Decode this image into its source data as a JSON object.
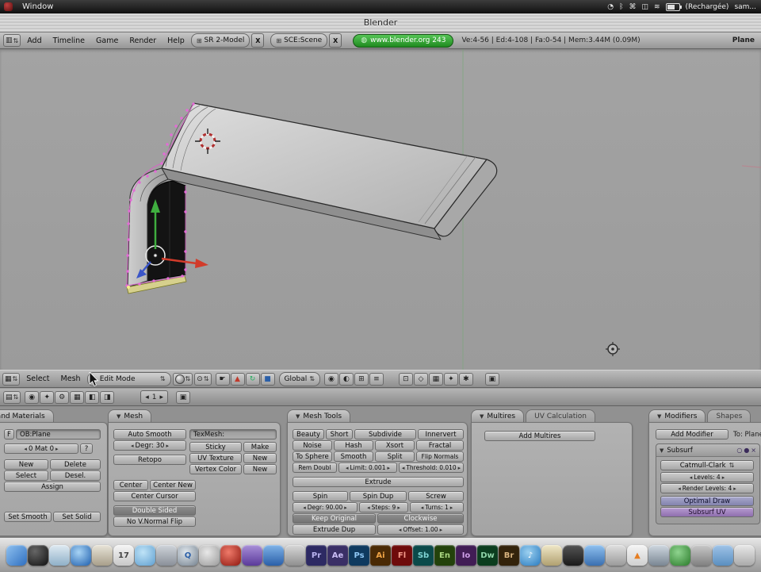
{
  "mac": {
    "window_menu": "Window",
    "status_icons": [
      "◔",
      "ᛒ",
      "⌘",
      "◫",
      "≋"
    ],
    "battery_label": "(Rechargée)",
    "user_label": "sam..."
  },
  "window": {
    "title": "Blender"
  },
  "top_header": {
    "menus": [
      "Add",
      "Timeline",
      "Game",
      "Render",
      "Help"
    ],
    "screen": "SR 2-Model",
    "screen_close": "X",
    "scene": "SCE:Scene",
    "scene_close": "X",
    "site_pill": "www.blender.org 243",
    "stats": "Ve:4-56 | Ed:4-108 | Fa:0-54 | Mem:3.44M (0.09M)",
    "object_name": "Plane"
  },
  "viewport_header": {
    "select": "Select",
    "mesh": "Mesh",
    "mode": "Edit Mode",
    "orientation": "Global"
  },
  "buttons_header": {
    "frame": "1"
  },
  "panels": {
    "link": {
      "title": "Link and Materials",
      "f": "F",
      "ob": "OB:Plane",
      "mat": "0 Mat 0",
      "help": "?",
      "new": "New",
      "delete": "Delete",
      "select": "Select",
      "desel": "Desel.",
      "assign": "Assign",
      "set_smooth": "Set Smooth",
      "set_solid": "Set Solid"
    },
    "mesh": {
      "title": "Mesh",
      "auto_smooth": "Auto Smooth",
      "degr": "Degr: 30",
      "retopo": "Retopo",
      "texmesh": "TexMesh:",
      "sticky": "Sticky",
      "make": "Make",
      "uv_texture": "UV Texture",
      "uv_new": "New",
      "vertex_color": "Vertex Color",
      "vcol_new": "New",
      "center": "Center",
      "center_new": "Center New",
      "center_cursor": "Center Cursor",
      "double_sided": "Double Sided",
      "no_vnormal": "No V.Normal Flip"
    },
    "mesh_tools": {
      "title": "Mesh Tools",
      "beauty": "Beauty",
      "short": "Short",
      "subdivide": "Subdivide",
      "innervert": "Innervert",
      "noise": "Noise",
      "hash": "Hash",
      "xsort": "Xsort",
      "fractal": "Fractal",
      "to_sphere": "To Sphere",
      "smooth": "Smooth",
      "split": "Split",
      "flip_normals": "Flip Normals",
      "rem_doubl": "Rem Doubl",
      "limit": "Limit: 0.001",
      "threshold": "Threshold: 0.010",
      "extrude": "Extrude",
      "spin": "Spin",
      "spin_dup": "Spin Dup",
      "screw": "Screw",
      "degr": "Degr: 90.00",
      "steps": "Steps: 9",
      "turns": "Turns: 1",
      "keep_original": "Keep Original",
      "clockwise": "Clockwise",
      "extrude_dup": "Extrude Dup",
      "offset": "Offset: 1.00"
    },
    "multires": {
      "title": "Multires",
      "tab_uv": "UV Calculation",
      "add_multires": "Add Multires"
    },
    "modifiers": {
      "title": "Modifiers",
      "tab_shapes": "Shapes",
      "add_modifier": "Add Modifier",
      "to": "To: Plane",
      "name": "Subsurf",
      "type": "Catmull-Clark",
      "levels": "Levels: 4",
      "render_levels": "Render Levels: 4",
      "optimal": "Optimal Draw",
      "subsurf_uv": "Subsurf UV"
    }
  },
  "dock": {
    "items": [
      {
        "name": "finder",
        "bg": "linear-gradient(135deg,#8fc1f0,#2f6fc0)",
        "label": ""
      },
      {
        "name": "dashboard",
        "bg": "radial-gradient(circle at 35% 30%,#666,#111)",
        "label": ""
      },
      {
        "name": "mail",
        "bg": "linear-gradient(#dfeaf2,#8fb0c8)",
        "label": ""
      },
      {
        "name": "browser",
        "bg": "radial-gradient(circle at 40% 35%,#a8d4f5,#1e5fae)",
        "label": ""
      },
      {
        "name": "address-book",
        "bg": "linear-gradient(#e8e4d8,#a89f8a)",
        "label": ""
      },
      {
        "name": "ical",
        "bg": "linear-gradient(#f5f5f5,#c8c8c8)",
        "label": "17",
        "fg": "#444"
      },
      {
        "name": "ichat",
        "bg": "radial-gradient(circle at 40% 35%,#bfe3f7,#5f9fd0)",
        "label": ""
      },
      {
        "name": "system-prefs",
        "bg": "linear-gradient(#cfd4da,#8a9099)",
        "label": ""
      },
      {
        "name": "quicktime",
        "bg": "radial-gradient(circle at 40% 35%,#dfe6ec,#75828f)",
        "label": "Q",
        "fg": "#2a5fa8"
      },
      {
        "name": "dvd-player",
        "bg": "radial-gradient(circle at 40% 35%,#e8e8e8,#9a9a9a)",
        "label": ""
      },
      {
        "name": "red-app",
        "bg": "radial-gradient(circle at 40% 35%,#ef7a6a,#8f1810)",
        "label": ""
      },
      {
        "name": "purple-app",
        "bg": "linear-gradient(#a88fd8,#5a3a9a)",
        "label": ""
      },
      {
        "name": "blue-app",
        "bg": "linear-gradient(#7fb3e8,#2a5fa8)",
        "label": ""
      },
      {
        "name": "gray-app",
        "bg": "linear-gradient(#d8d8d8,#8f8f8f)",
        "label": ""
      },
      {
        "name": "premiere",
        "bg": "#2d2a63",
        "label": "Pr",
        "fg": "#b9b3ef",
        "shape": "sq"
      },
      {
        "name": "after-effects",
        "bg": "#3a2f66",
        "label": "Ae",
        "fg": "#cabdf5",
        "shape": "sq"
      },
      {
        "name": "photoshop",
        "bg": "#0f3a5f",
        "label": "Ps",
        "fg": "#8fc8f5",
        "shape": "sq"
      },
      {
        "name": "illustrator",
        "bg": "#4a2a05",
        "label": "Ai",
        "fg": "#f0a445",
        "shape": "sq"
      },
      {
        "name": "flash",
        "bg": "#6e0b0b",
        "label": "Fl",
        "fg": "#f59a8a",
        "shape": "sq"
      },
      {
        "name": "soundbooth",
        "bg": "#0b4a4a",
        "label": "Sb",
        "fg": "#7fd4d4",
        "shape": "sq"
      },
      {
        "name": "encore",
        "bg": "#23420b",
        "label": "En",
        "fg": "#a9d67f",
        "shape": "sq"
      },
      {
        "name": "indesign",
        "bg": "#411d55",
        "label": "Io",
        "fg": "#cf9fe8",
        "shape": "sq"
      },
      {
        "name": "dreamweaver",
        "bg": "#0b3d1e",
        "label": "Dw",
        "fg": "#8fd4a8",
        "shape": "sq"
      },
      {
        "name": "bridge",
        "bg": "#33230b",
        "label": "Br",
        "fg": "#d8b37f",
        "shape": "sq"
      },
      {
        "name": "itunes",
        "bg": "radial-gradient(circle at 40% 35%,#9bd0f0,#2a7bc0)",
        "label": "♪",
        "fg": "#fff"
      },
      {
        "name": "photo-app",
        "bg": "linear-gradient(#f0e8c8,#b0a070)",
        "label": ""
      },
      {
        "name": "dark-app",
        "bg": "linear-gradient(#555,#1a1a1a)",
        "label": ""
      },
      {
        "name": "blue-app-2",
        "bg": "linear-gradient(#8fc1f0,#3a6fb0)",
        "label": ""
      },
      {
        "name": "silver-app",
        "bg": "linear-gradient(#e0e0e0,#9a9a9a)",
        "label": ""
      },
      {
        "name": "vlc",
        "bg": "linear-gradient(#f5f5f5,#d0d0d0)",
        "label": "▲",
        "fg": "#e67e22"
      },
      {
        "name": "calculator",
        "bg": "linear-gradient(#cfd8e0,#7a8693)",
        "label": ""
      },
      {
        "name": "music-app",
        "bg": "radial-gradient(circle at 40% 35%,#8fd48f,#2a7b2a)",
        "label": ""
      },
      {
        "name": "gray-app-2",
        "bg": "linear-gradient(#c8c8c8,#808080)",
        "label": ""
      },
      {
        "name": "folder",
        "bg": "linear-gradient(#9fc3e8,#5a8fc0)",
        "label": ""
      },
      {
        "name": "trash",
        "bg": "linear-gradient(#e8e8e8,#aaaaaa)",
        "label": ""
      }
    ]
  }
}
